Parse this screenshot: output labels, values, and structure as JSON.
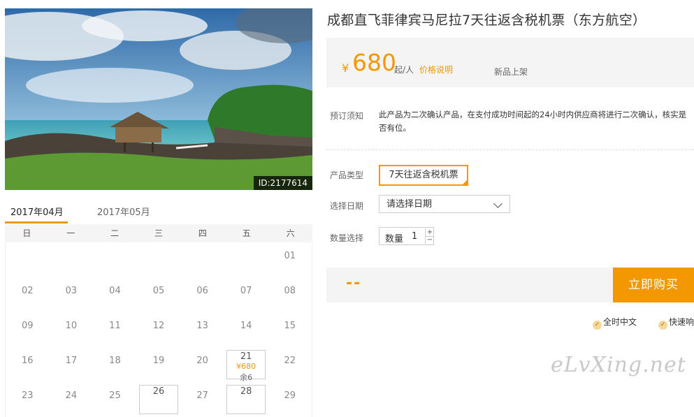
{
  "hero": {
    "image_id": "ID:2177614"
  },
  "calendar": {
    "tabs": [
      "2017年04月",
      "2017年05月"
    ],
    "weekdays": [
      "日",
      "一",
      "二",
      "三",
      "四",
      "五",
      "六"
    ],
    "weeks": [
      [
        {
          "d": ""
        },
        {
          "d": ""
        },
        {
          "d": ""
        },
        {
          "d": ""
        },
        {
          "d": ""
        },
        {
          "d": ""
        },
        {
          "d": "01"
        }
      ],
      [
        {
          "d": "02"
        },
        {
          "d": "03"
        },
        {
          "d": "04"
        },
        {
          "d": "05"
        },
        {
          "d": "06"
        },
        {
          "d": "07"
        },
        {
          "d": "08"
        }
      ],
      [
        {
          "d": "09"
        },
        {
          "d": "10"
        },
        {
          "d": "11"
        },
        {
          "d": "12"
        },
        {
          "d": "13"
        },
        {
          "d": "14"
        },
        {
          "d": "15"
        }
      ],
      [
        {
          "d": "16"
        },
        {
          "d": "17"
        },
        {
          "d": "18"
        },
        {
          "d": "19"
        },
        {
          "d": "20"
        },
        {
          "d": "21",
          "price": "¥680",
          "left": "余6"
        },
        {
          "d": "22"
        }
      ],
      [
        {
          "d": "23"
        },
        {
          "d": "24"
        },
        {
          "d": "25"
        },
        {
          "d": "26",
          "avail": true
        },
        {
          "d": "27"
        },
        {
          "d": "28",
          "avail": true
        },
        {
          "d": "29"
        }
      ]
    ]
  },
  "product": {
    "title": "成都直飞菲律宾马尼拉7天往返含税机票（东方航空）",
    "currency": "¥",
    "price": "680",
    "unit": "起/人",
    "price_note": "价格说明",
    "new_tag": "新品上架",
    "notice_label": "预订须知",
    "notice_text": "此产品为二次确认产品，在支付成功时间起的24小时内供应商将进行二次确认，核实是否有位。",
    "type_label": "产品类型",
    "type_option": "7天往返含税机票",
    "date_label": "选择日期",
    "date_placeholder": "请选择日期",
    "qty_section_label": "数量选择",
    "qty_label": "数量",
    "qty_value": "1",
    "qty_plus": "+",
    "qty_minus": "−",
    "total": "--",
    "buy_label": "立即购买",
    "guarantees": [
      "全时中文",
      "快速响应"
    ]
  },
  "watermark": "eLvXing.net",
  "colors": {
    "accent": "#f39800",
    "panel": "#f4f4f4"
  }
}
